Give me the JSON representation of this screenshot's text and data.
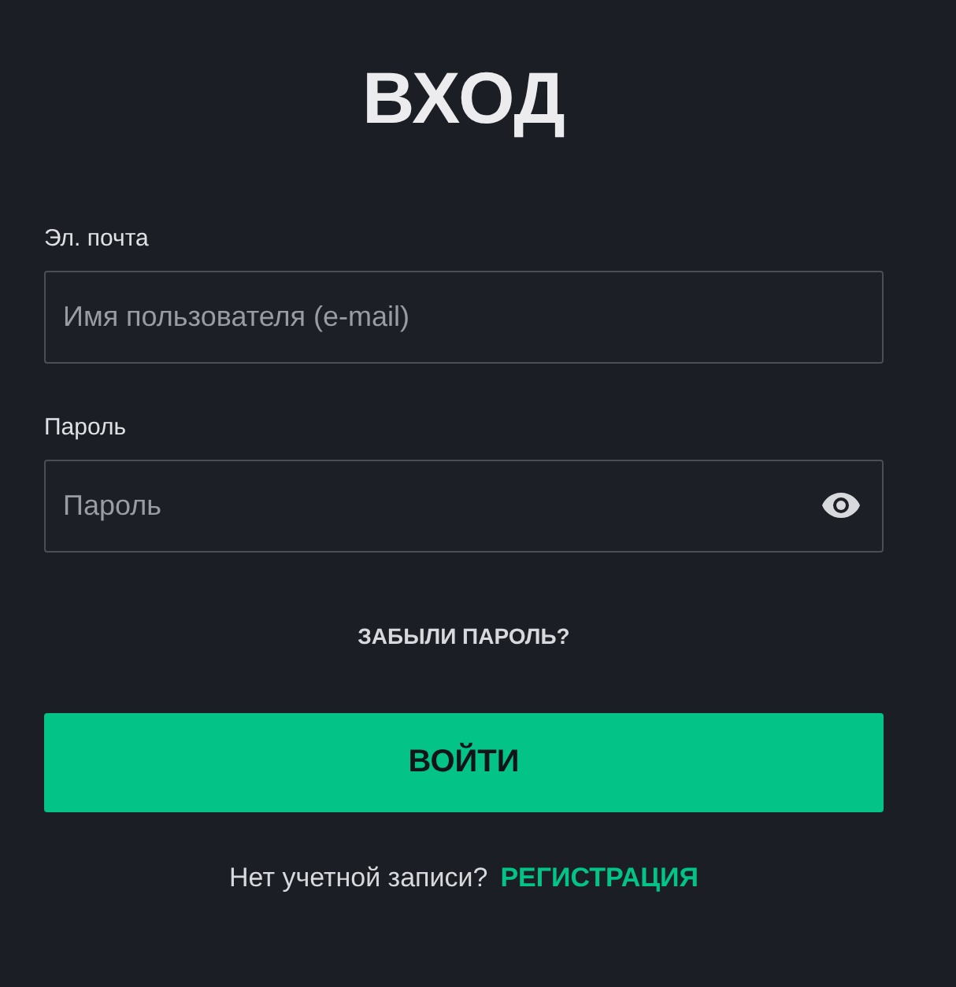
{
  "title": "ВХОД",
  "fields": [
    {
      "label": "Эл. почта",
      "placeholder": "Имя пользователя (e-mail)",
      "kind": "text"
    },
    {
      "label": "Пароль",
      "placeholder": "Пароль",
      "kind": "password"
    }
  ],
  "forgot_link": "ЗАБЫЛИ ПАРОЛЬ?",
  "submit_button": "ВОЙТИ",
  "signup": {
    "prompt": "Нет учетной записи?",
    "link": "РЕГИСТРАЦИЯ"
  }
}
